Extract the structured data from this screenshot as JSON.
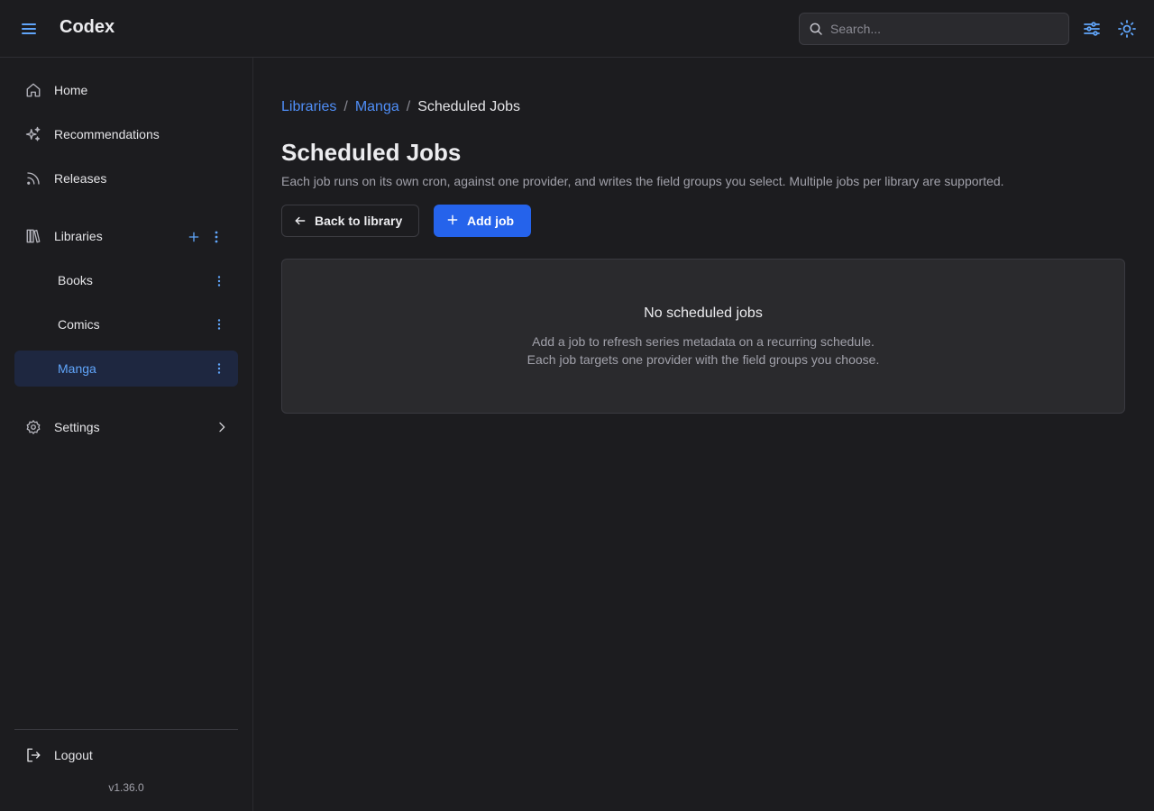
{
  "colors": {
    "accent": "#4f8ef7",
    "primary_button": "#2563eb",
    "background": "#1c1c1f",
    "card": "#2a2a2d",
    "active_nav_bg": "#1e2740"
  },
  "header": {
    "menu_icon": "hamburger-menu-icon",
    "app_title": "Codex",
    "search": {
      "placeholder": "Search...",
      "value": "",
      "icon": "search-icon"
    },
    "filters_icon": "sliders-icon",
    "theme_icon": "sun-icon"
  },
  "sidebar": {
    "nav": [
      {
        "label": "Home",
        "icon": "home-icon"
      },
      {
        "label": "Recommendations",
        "icon": "sparkles-icon"
      },
      {
        "label": "Releases",
        "icon": "rss-icon"
      }
    ],
    "libraries": {
      "label": "Libraries",
      "icon": "library-icon",
      "items": [
        {
          "label": "Books",
          "active": false
        },
        {
          "label": "Comics",
          "active": false
        },
        {
          "label": "Manga",
          "active": true
        }
      ]
    },
    "settings": {
      "label": "Settings",
      "icon": "gear-icon"
    },
    "logout": {
      "label": "Logout",
      "icon": "logout-icon"
    },
    "version": "v1.36.0"
  },
  "main": {
    "breadcrumb": {
      "items": [
        "Libraries",
        "Manga"
      ],
      "separator": "/",
      "current": "Scheduled Jobs"
    },
    "title": "Scheduled Jobs",
    "description": "Each job runs on its own cron, against one provider, and writes the field groups you select. Multiple jobs per library are supported.",
    "buttons": {
      "back_label": "Back to library",
      "add_label": "Add job"
    },
    "empty_state": {
      "title": "No scheduled jobs",
      "line1": "Add a job to refresh series metadata on a recurring schedule.",
      "line2": "Each job targets one provider with the field groups you choose."
    }
  }
}
